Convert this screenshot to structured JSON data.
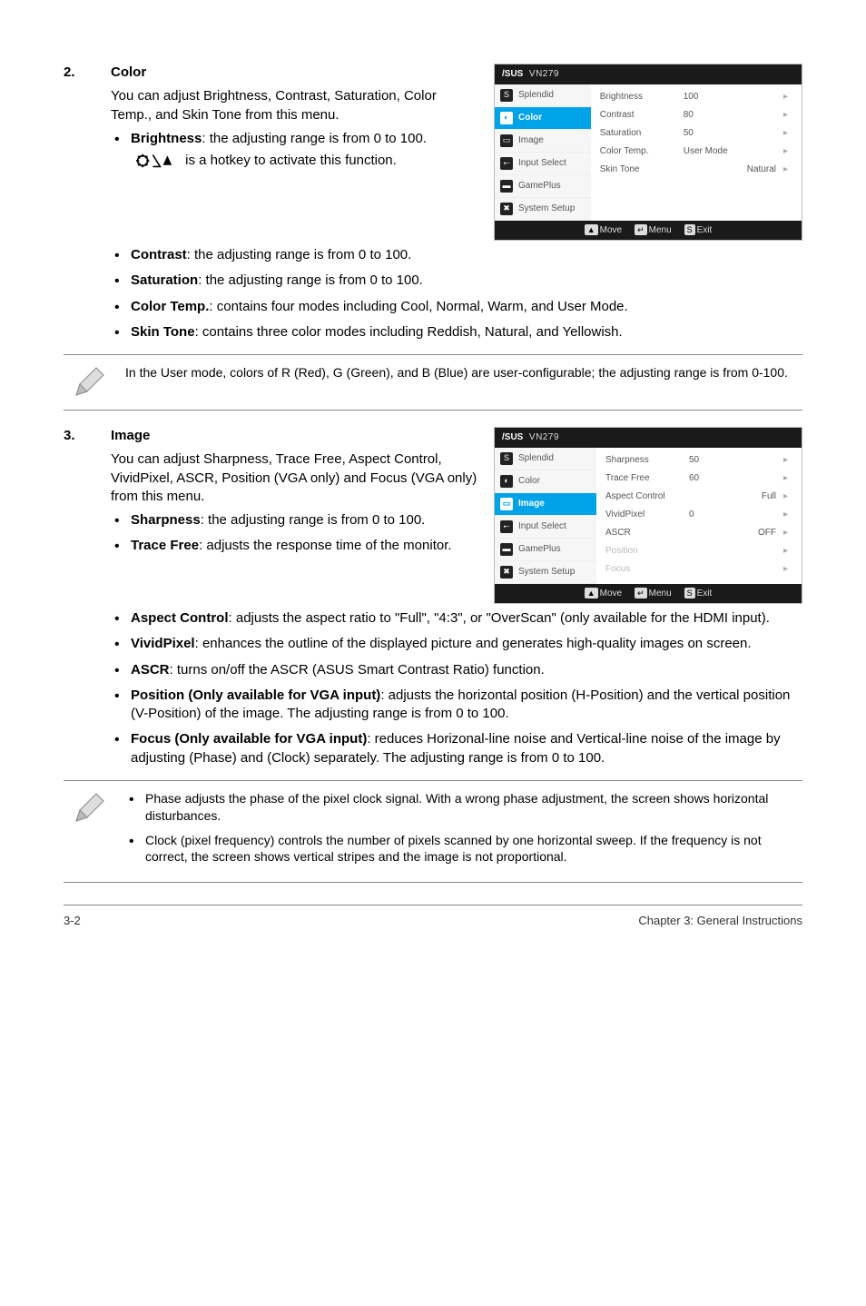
{
  "sections": {
    "s2": {
      "num": "2.",
      "title": "Color",
      "intro": "You can adjust Brightness, Contrast, Saturation, Color Temp., and Skin Tone from this menu.",
      "items": [
        {
          "bold": "Brightness",
          "text": ": the adjusting range is from 0 to 100.",
          "hotkey_tail": " is a hotkey to activate this function."
        },
        {
          "bold": "Contrast",
          "text": ": the adjusting range is from 0 to 100."
        },
        {
          "bold": "Saturation",
          "text": ": the adjusting range is from 0 to 100."
        },
        {
          "bold": "Color Temp.",
          "text": ": contains four modes including Cool, Normal, Warm, and User Mode."
        },
        {
          "bold": "Skin Tone",
          "text": ": contains three color modes including Reddish, Natural, and Yellowish."
        }
      ],
      "note": "In the User mode, colors of R (Red), G (Green), and B (Blue) are user-configurable; the adjusting range is from 0-100."
    },
    "s3": {
      "num": "3.",
      "title": "Image",
      "intro": "You can adjust Sharpness, Trace Free, Aspect Control, VividPixel, ASCR, Position (VGA only) and Focus (VGA only) from this menu.",
      "items": [
        {
          "bold": "Sharpness",
          "text": ": the adjusting range is from 0 to 100."
        },
        {
          "bold": "Trace Free",
          "text": ": adjusts the response time of the monitor."
        },
        {
          "bold": "Aspect Control",
          "text": ": adjusts the aspect ratio to \"Full\", \"4:3\", or \"OverScan\" (only available for the HDMI input)."
        },
        {
          "bold": "VividPixel",
          "text": ": enhances the outline of the displayed picture and generates high-quality images on screen."
        },
        {
          "bold": "ASCR",
          "text": ": turns on/off the ASCR (ASUS Smart Contrast Ratio) function."
        },
        {
          "bold": "Position (Only available for VGA input)",
          "text": ": adjusts the horizontal position (H-Position) and the vertical position (V-Position) of the image. The adjusting range is from 0 to 100."
        },
        {
          "bold": "Focus (Only available for VGA input)",
          "text": ": reduces Horizonal-line noise and Vertical-line noise of the image by adjusting (Phase) and (Clock) separately. The adjusting range is from 0 to 100."
        }
      ],
      "note_items": [
        "Phase adjusts the phase of the pixel clock signal. With a wrong phase adjustment, the screen shows horizontal disturbances.",
        "Clock (pixel frequency) controls the number of pixels scanned by one horizontal sweep. If the frequency is not correct, the screen shows vertical stripes and the image is not proportional."
      ]
    }
  },
  "osd": {
    "brand": "/SUS",
    "model": "VN279",
    "side": {
      "splendid": "Splendid",
      "color": "Color",
      "image": "Image",
      "input": "Input Select",
      "gameplus": "GamePlus",
      "system": "System Setup"
    },
    "foot": {
      "move": "Move",
      "menu": "Menu",
      "exit": "Exit"
    },
    "color_rows": [
      {
        "label": "Brightness",
        "value": "100",
        "extra": ""
      },
      {
        "label": "Contrast",
        "value": "80",
        "extra": ""
      },
      {
        "label": "Saturation",
        "value": "50",
        "extra": ""
      },
      {
        "label": "Color Temp.",
        "value": "User Mode",
        "extra": ""
      },
      {
        "label": "Skin Tone",
        "value": "",
        "extra": "Natural"
      }
    ],
    "image_rows": [
      {
        "label": "Sharpness",
        "value": "50",
        "extra": "",
        "dim": false
      },
      {
        "label": "Trace Free",
        "value": "60",
        "extra": "",
        "dim": false
      },
      {
        "label": "Aspect Control",
        "value": "",
        "extra": "Full",
        "dim": false
      },
      {
        "label": "VividPixel",
        "value": "0",
        "extra": "",
        "dim": false
      },
      {
        "label": "ASCR",
        "value": "",
        "extra": "OFF",
        "dim": false
      },
      {
        "label": "Position",
        "value": "",
        "extra": "",
        "dim": true
      },
      {
        "label": "Focus",
        "value": "",
        "extra": "",
        "dim": true
      }
    ]
  },
  "footer": {
    "left": "3-2",
    "right": "Chapter 3: General Instructions"
  }
}
